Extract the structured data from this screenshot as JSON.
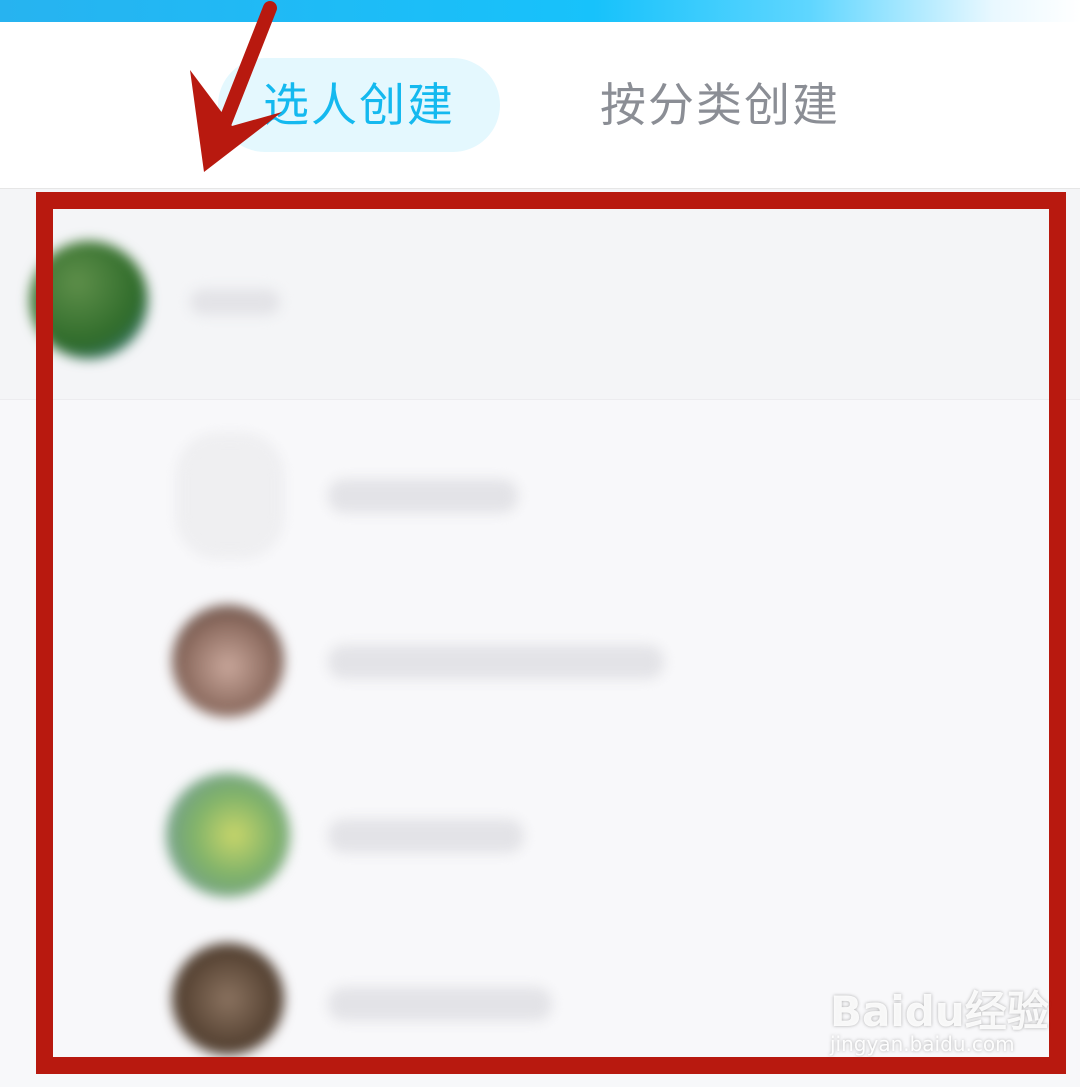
{
  "tabs": [
    {
      "label": "选人创建",
      "active": true
    },
    {
      "label": "按分类创建",
      "active": false
    }
  ],
  "colors": {
    "accent": "#14b9ef",
    "tab_active_bg": "#e4f8fe",
    "tab_inactive_text": "#8b8e95",
    "annotation_red": "#b8190f"
  },
  "contact_rows": [
    "group-entry",
    "contact-1",
    "contact-2",
    "contact-3",
    "contact-4"
  ],
  "watermark": {
    "logo": "Baidu经验",
    "url": "jingyan.baidu.com"
  }
}
